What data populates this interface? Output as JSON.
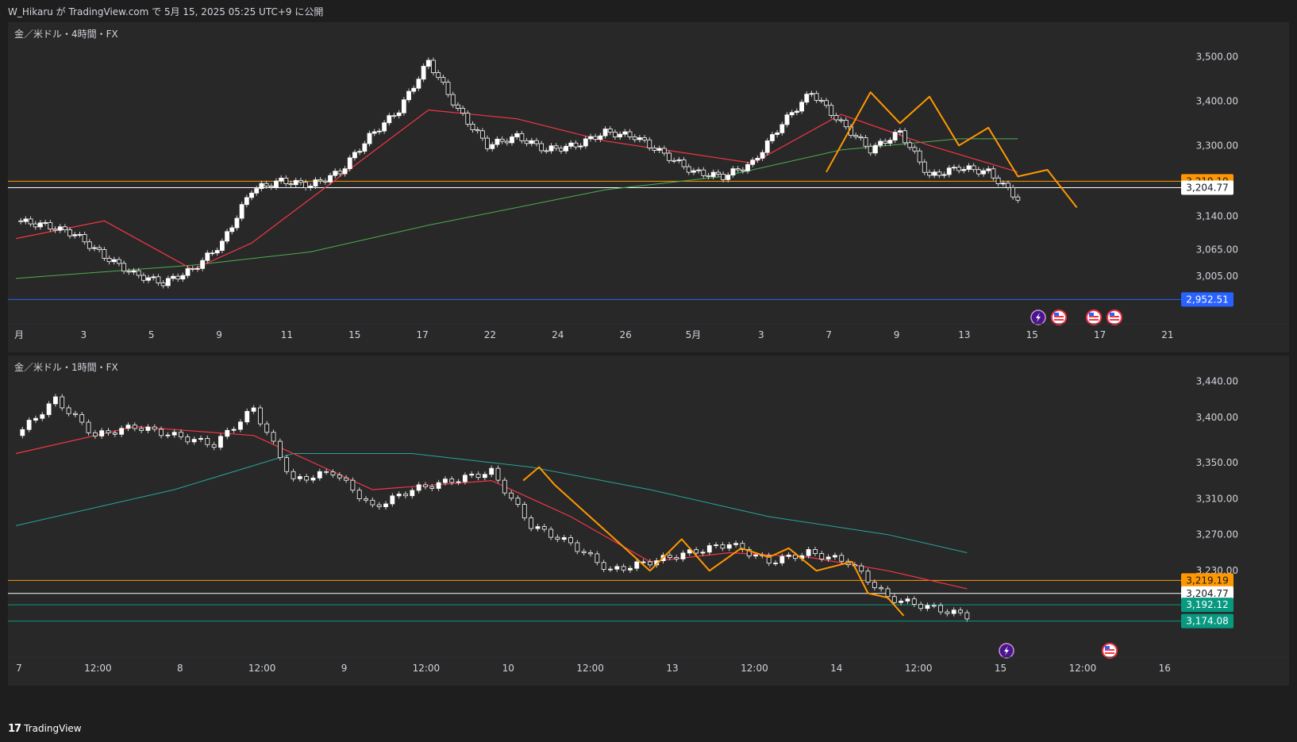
{
  "header": {
    "text": "W_Hikaru が TradingView.com で 5月 15, 2025 05:25 UTC+9 に公開"
  },
  "footer": {
    "brand": "TradingView",
    "logo_icon": "tradingview-logo-icon"
  },
  "colors": {
    "up": "#089981",
    "down": "#f23645",
    "candle_body": "#e6e6e6",
    "ma_fast": "#f23645",
    "ma_slow_4h": "#4caf50",
    "ma_slow_1h": "#26a69a",
    "zigzag": "#ff9800",
    "level_orange": "#ff9800",
    "level_white": "#ffffff",
    "level_blue": "#2962ff",
    "level_teal": "#089981"
  },
  "chart_data": [
    {
      "type": "candlestick",
      "title": "金／米ドル・4時間・FX",
      "ylim": [
        2930,
        3560
      ],
      "y_ticks": [
        "3,500.00",
        "3,400.00",
        "3,300.00",
        "3,140.00",
        "3,065.00",
        "3,005.00"
      ],
      "x_ticks": [
        "月",
        "3",
        "5",
        "9",
        "11",
        "15",
        "17",
        "22",
        "24",
        "26",
        "5月",
        "3",
        "7",
        "9",
        "13",
        "15",
        "17",
        "21"
      ],
      "series": [
        {
          "name": "close",
          "points": [
            [
              0,
              3130
            ],
            [
              1,
              3120
            ],
            [
              2,
              3100
            ],
            [
              3,
              3050
            ],
            [
              4,
              3010
            ],
            [
              5,
              2990
            ],
            [
              6,
              3020
            ],
            [
              7,
              3080
            ],
            [
              8,
              3200
            ],
            [
              9,
              3220
            ],
            [
              10,
              3210
            ],
            [
              11,
              3240
            ],
            [
              12,
              3320
            ],
            [
              13,
              3380
            ],
            [
              14,
              3490
            ],
            [
              15,
              3380
            ],
            [
              16,
              3300
            ],
            [
              17,
              3320
            ],
            [
              18,
              3290
            ],
            [
              19,
              3300
            ],
            [
              20,
              3330
            ],
            [
              21,
              3320
            ],
            [
              22,
              3280
            ],
            [
              23,
              3240
            ],
            [
              24,
              3230
            ],
            [
              25,
              3260
            ],
            [
              26,
              3350
            ],
            [
              27,
              3420
            ],
            [
              28,
              3350
            ],
            [
              29,
              3290
            ],
            [
              30,
              3330
            ],
            [
              31,
              3230
            ],
            [
              32,
              3250
            ],
            [
              33,
              3240
            ],
            [
              34,
              3180
            ]
          ]
        },
        {
          "name": "ma_fast",
          "points": [
            [
              0,
              3090
            ],
            [
              3,
              3130
            ],
            [
              6,
              3020
            ],
            [
              8,
              3080
            ],
            [
              11,
              3230
            ],
            [
              14,
              3380
            ],
            [
              17,
              3360
            ],
            [
              20,
              3310
            ],
            [
              23,
              3280
            ],
            [
              25,
              3260
            ],
            [
              28,
              3370
            ],
            [
              31,
              3300
            ],
            [
              34,
              3240
            ]
          ]
        },
        {
          "name": "ma_slow",
          "points": [
            [
              0,
              3000
            ],
            [
              6,
              3030
            ],
            [
              10,
              3060
            ],
            [
              14,
              3120
            ],
            [
              20,
              3200
            ],
            [
              24,
              3230
            ],
            [
              28,
              3290
            ],
            [
              32,
              3315
            ],
            [
              34,
              3315
            ]
          ]
        },
        {
          "name": "zigzag",
          "points": [
            [
              27.5,
              3240
            ],
            [
              29,
              3420
            ],
            [
              30,
              3350
            ],
            [
              31,
              3410
            ],
            [
              32,
              3300
            ],
            [
              33,
              3340
            ],
            [
              34,
              3230
            ],
            [
              35,
              3245
            ],
            [
              36,
              3160
            ]
          ]
        }
      ],
      "levels": [
        {
          "value": 3219.19,
          "label": "3,219.19",
          "color": "#ff9800"
        },
        {
          "value": 3204.77,
          "label": "3,204.77",
          "color": "#ffffff"
        },
        {
          "value": 2952.51,
          "label": "2,952.51",
          "color": "#2962ff"
        }
      ],
      "event_icons": [
        "lightning-icon",
        "us-flag-icon",
        "us-flag-icon",
        "us-flag-icon"
      ]
    },
    {
      "type": "candlestick",
      "title": "金／米ドル・1時間・FX",
      "ylim": [
        3150,
        3460
      ],
      "y_ticks": [
        "3,440.00",
        "3,400.00",
        "3,350.00",
        "3,310.00",
        "3,270.00",
        "3,230.00"
      ],
      "x_ticks": [
        "7",
        "12:00",
        "8",
        "12:00",
        "9",
        "12:00",
        "10",
        "12:00",
        "13",
        "12:00",
        "14",
        "12:00",
        "15",
        "12:00",
        "16"
      ],
      "series": [
        {
          "name": "close",
          "points": [
            [
              0,
              3380
            ],
            [
              1,
              3420
            ],
            [
              2,
              3380
            ],
            [
              3,
              3390
            ],
            [
              4,
              3380
            ],
            [
              5,
              3370
            ],
            [
              6,
              3410
            ],
            [
              7,
              3330
            ],
            [
              8,
              3340
            ],
            [
              9,
              3300
            ],
            [
              10,
              3320
            ],
            [
              11,
              3330
            ],
            [
              12,
              3340
            ],
            [
              13,
              3280
            ],
            [
              14,
              3260
            ],
            [
              15,
              3230
            ],
            [
              16,
              3240
            ],
            [
              17,
              3250
            ],
            [
              18,
              3260
            ],
            [
              19,
              3240
            ],
            [
              20,
              3250
            ],
            [
              21,
              3240
            ],
            [
              22,
              3200
            ],
            [
              23,
              3190
            ],
            [
              24,
              3180
            ]
          ]
        },
        {
          "name": "ma_fast",
          "points": [
            [
              0,
              3360
            ],
            [
              3,
              3390
            ],
            [
              6,
              3380
            ],
            [
              9,
              3320
            ],
            [
              12,
              3330
            ],
            [
              14,
              3290
            ],
            [
              16,
              3240
            ],
            [
              18,
              3250
            ],
            [
              20,
              3245
            ],
            [
              22,
              3230
            ],
            [
              24,
              3210
            ]
          ]
        },
        {
          "name": "ma_slow",
          "points": [
            [
              0,
              3280
            ],
            [
              4,
              3320
            ],
            [
              7,
              3360
            ],
            [
              10,
              3360
            ],
            [
              13,
              3345
            ],
            [
              16,
              3320
            ],
            [
              19,
              3290
            ],
            [
              22,
              3270
            ],
            [
              24,
              3250
            ]
          ]
        },
        {
          "name": "zigzag",
          "points": [
            [
              12.8,
              3330
            ],
            [
              13.2,
              3345
            ],
            [
              13.6,
              3325
            ],
            [
              16,
              3230
            ],
            [
              16.8,
              3265
            ],
            [
              17.5,
              3230
            ],
            [
              18.3,
              3255
            ],
            [
              19,
              3245
            ],
            [
              19.5,
              3255
            ],
            [
              20.2,
              3230
            ],
            [
              21.1,
              3240
            ],
            [
              21.5,
              3205
            ],
            [
              22,
              3200
            ],
            [
              22.4,
              3180
            ]
          ]
        }
      ],
      "levels": [
        {
          "value": 3219.19,
          "label": "3,219.19",
          "color": "#ff9800"
        },
        {
          "value": 3204.77,
          "label": "3,204.77",
          "color": "#ffffff"
        },
        {
          "value": 3192.12,
          "label": "3,192.12",
          "color": "#089981"
        },
        {
          "value": 3174.08,
          "label": "3,174.08",
          "color": "#089981"
        }
      ],
      "event_icons": [
        "lightning-icon",
        "us-flag-icon"
      ]
    }
  ]
}
